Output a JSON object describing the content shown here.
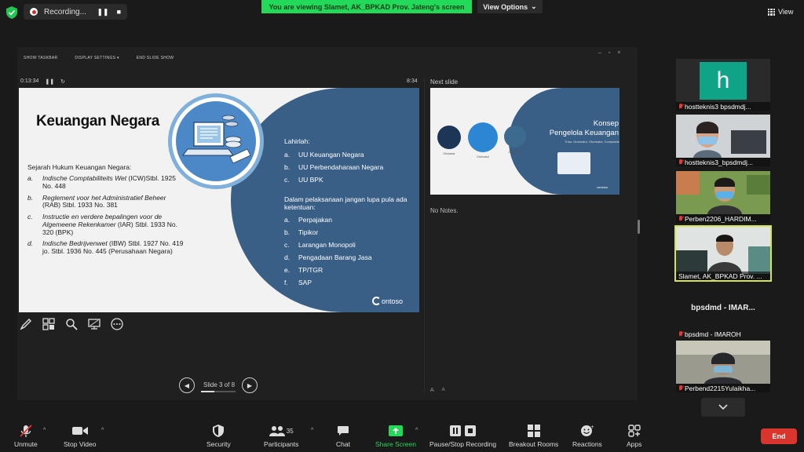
{
  "top_bar": {
    "recording_label": "Recording...",
    "pause_glyph": "❚❚",
    "stop_glyph": "■",
    "viewing_banner": "You are viewing Slamet, AK_BPKAD Prov. Jateng's screen",
    "view_options_label": "View Options",
    "view_label": "View"
  },
  "presenter": {
    "toolbar": {
      "show_taskbar": "SHOW TASKBAR",
      "display_settings": "DISPLAY SETTINGS ▾",
      "end_slide_show": "END SLIDE SHOW"
    },
    "window_controls": {
      "minimize": "–",
      "restore": "▫",
      "close": "×"
    },
    "elapsed_time": "0:13:34",
    "clock": "8:34",
    "next_slide_label": "Next slide",
    "notes_text": "No Notes.",
    "slide_counter": "Slide 3 of 8",
    "slide_progress": 0.375,
    "text_size_small": "A",
    "text_size_large": "A"
  },
  "slide": {
    "title": "Keuangan Negara",
    "left_heading": "Sejarah Hukum Keuangan Negara:",
    "left_items": [
      {
        "marker": "a.",
        "italic": "Indische Comptabiliteits Wet",
        "rest": " (ICW)Stbl. 1925 No. 448"
      },
      {
        "marker": "b.",
        "italic": "Reglement voor het Administratief Beheer",
        "rest": " (RAB) Stbl. 1933 No. 381"
      },
      {
        "marker": "c.",
        "italic": "Instructie en verdere bepalingen voor de Algemeene Rekenkamer",
        "rest": " (IAR) Stbl. 1933 No. 320 (BPK)"
      },
      {
        "marker": "d.",
        "italic": "Indische Bedrijvenwet",
        "rest": " (IBW) Stbl. 1927 No. 419 jo. Stbl. 1936 No. 445 (Perusahaan Negara)"
      }
    ],
    "right_heading_1": "Lahirlah:",
    "right_items_1": [
      {
        "marker": "a.",
        "text": "UU Keuangan Negara"
      },
      {
        "marker": "b.",
        "text": "UU Perbendaharaan Negara"
      },
      {
        "marker": "c.",
        "text": "UU BPK"
      }
    ],
    "right_heading_2": "Dalam pelaksanaan jangan lupa pula ada ketentuan:",
    "right_items_2": [
      {
        "marker": "a.",
        "text": "Perpajakan"
      },
      {
        "marker": "b.",
        "text": "Tipikor"
      },
      {
        "marker": "c.",
        "text": "Larangan Monopoli"
      },
      {
        "marker": "d.",
        "text": "Pengadaan Barang Jasa"
      },
      {
        "marker": "e.",
        "text": "TP/TGR"
      },
      {
        "marker": "f.",
        "text": "SAP"
      }
    ],
    "logo_text": "ontoso"
  },
  "next_slide": {
    "title_line1": "Konsep",
    "title_line2": "Pengelola Keuangan",
    "subtitle": "Trias: Ordonatur, Otorisator, Comptable",
    "labels": [
      "Otorisator",
      "Ordonatur",
      "Comptable"
    ],
    "logo_text": "contoso"
  },
  "participants": [
    {
      "name": "hostteknis3 bpsdmdj...",
      "avatar_letter": "h",
      "type": "avatar"
    },
    {
      "name": "hostteknis3_bpsdmdj...",
      "type": "video"
    },
    {
      "name": "Perben2206_HARDIM...",
      "type": "video"
    },
    {
      "name": "Slamet, AK_BPKAD Prov. ...",
      "type": "video",
      "active": true
    },
    {
      "name": "bpsdmd - IMAROH",
      "display_name": "bpsdmd - IMAR...",
      "type": "text"
    },
    {
      "name": "Perbend2215Yulaikha...",
      "type": "video"
    }
  ],
  "toolbar": {
    "unmute": "Unmute",
    "stop_video": "Stop Video",
    "security": "Security",
    "participants": "Participants",
    "participants_count": "35",
    "chat": "Chat",
    "share_screen": "Share Screen",
    "pause_stop_recording": "Pause/Stop Recording",
    "breakout_rooms": "Breakout Rooms",
    "reactions": "Reactions",
    "apps": "Apps",
    "end": "End"
  },
  "colors": {
    "banner_green": "#23d959",
    "slide_blue": "#3a5f86",
    "end_red": "#d9352e",
    "active_speaker": "#d7e34a",
    "share_green": "#23d959"
  }
}
